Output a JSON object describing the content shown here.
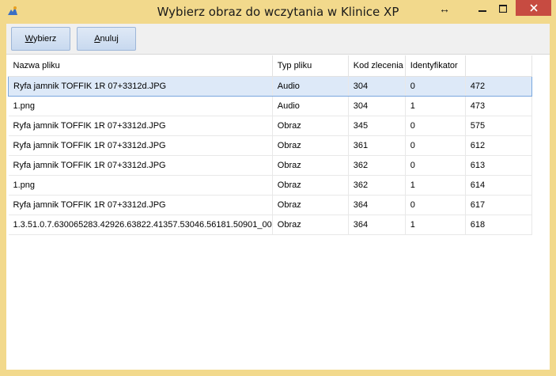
{
  "window": {
    "title": "Wybierz obraz do wczytania w Klinice XP",
    "resize_glyph": "↔",
    "minimize_glyph": "—",
    "maximize_glyph": "☐",
    "close_glyph": "✕",
    "accent": "#f2d98c",
    "close_color": "#c74b41"
  },
  "toolbar": {
    "select_underlined": "W",
    "select_rest": "ybierz",
    "cancel_underlined": "A",
    "cancel_rest": "nuluj"
  },
  "table": {
    "headers": [
      "Nazwa pliku",
      "Typ pliku",
      "Kod zlecenia",
      "Identyfikator",
      ""
    ],
    "selected_row": 0,
    "rows": [
      [
        "Ryfa jamnik TOFFIK 1R 07+3312d.JPG",
        "Audio",
        "304",
        "0",
        "472"
      ],
      [
        "1.png",
        "Audio",
        "304",
        "1",
        "473"
      ],
      [
        "Ryfa jamnik TOFFIK 1R 07+3312d.JPG",
        "Obraz",
        "345",
        "0",
        "575"
      ],
      [
        "Ryfa jamnik TOFFIK 1R 07+3312d.JPG",
        "Obraz",
        "361",
        "0",
        "612"
      ],
      [
        "Ryfa jamnik TOFFIK 1R 07+3312d.JPG",
        "Obraz",
        "362",
        "0",
        "613"
      ],
      [
        "1.png",
        "Obraz",
        "362",
        "1",
        "614"
      ],
      [
        "Ryfa jamnik TOFFIK 1R 07+3312d.JPG",
        "Obraz",
        "364",
        "0",
        "617"
      ],
      [
        "1.3.51.0.7.630065283.42926.63822.41357.53046.56181.50901_00",
        "Obraz",
        "364",
        "1",
        "618"
      ]
    ]
  }
}
